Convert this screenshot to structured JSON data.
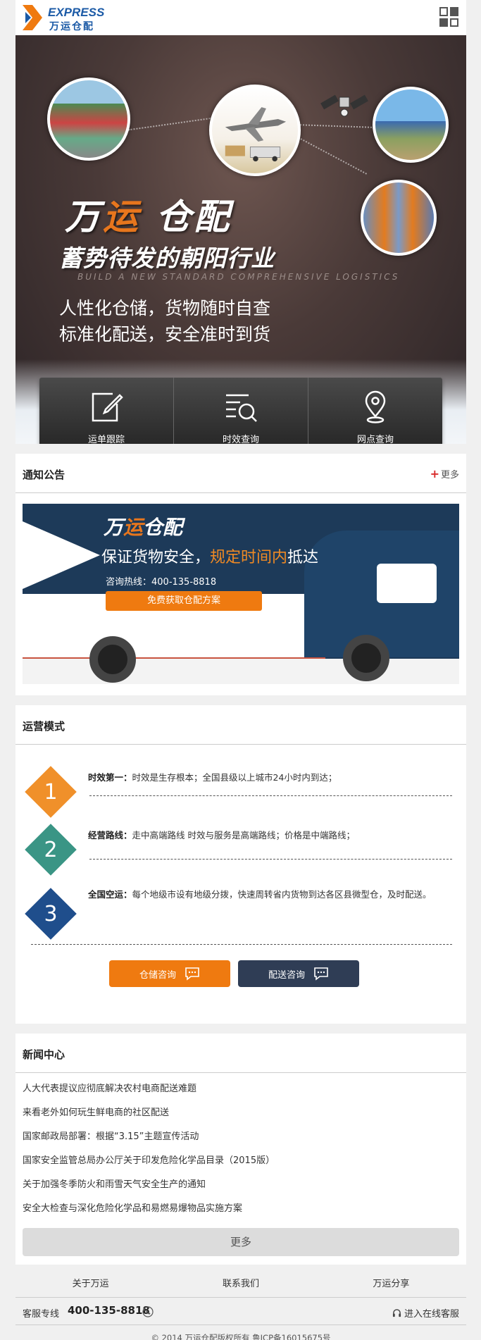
{
  "header": {
    "logo_en": "EXPRESS",
    "logo_cn": "万运仓配",
    "menu_icon": "grid-menu-icon"
  },
  "banner": {
    "brand_part1": "万",
    "brand_part2": "运",
    "brand_part3": " 仓配",
    "tagline": "蓄势待发的朝阳行业",
    "tagline_en": "BUILD A NEW STANDARD COMPREHENSIVE LOGISTICS",
    "line1": "人性化仓储，货物随时自查",
    "line2": "标准化配送，安全准时到货"
  },
  "quick": [
    {
      "label": "运单跟踪",
      "icon": "edit-note-icon"
    },
    {
      "label": "时效查询",
      "icon": "list-search-icon"
    },
    {
      "label": "网点查询",
      "icon": "location-pin-icon"
    }
  ],
  "notice": {
    "title": "通知公告",
    "more": "更多",
    "promo_logo1": "万",
    "promo_logo2": "运",
    "promo_logo3": "仓配",
    "promo_slogan_a": "保证货物安全，",
    "promo_slogan_b": "规定时间内",
    "promo_slogan_c": "抵达",
    "promo_hotline": "咨询热线：400-135-8818",
    "promo_button": "免费获取仓配方案"
  },
  "ops": {
    "title": "运营模式",
    "items": [
      {
        "num": "1",
        "head": "时效第一：",
        "text": "时效是生存根本；全国县级以上城市24小时内到达；",
        "color": "#f0902a"
      },
      {
        "num": "2",
        "head": "经营路线：",
        "text": "走中高端路线 时效与服务是高端路线；价格是中端路线；",
        "color": "#3a9585"
      },
      {
        "num": "3",
        "head": "全国空运：",
        "text": "每个地级市设有地级分拨，快速周转省内货物到达各区县微型仓，及时配送。",
        "color": "#1f4e8c"
      }
    ],
    "btn_storage": "仓储咨询",
    "btn_delivery": "配送咨询"
  },
  "news": {
    "title": "新闻中心",
    "items": [
      "人大代表提议应彻底解决农村电商配送难题",
      "来看老外如何玩生鲜电商的社区配送",
      "国家邮政局部署：根据“3.15”主题宣传活动",
      "国家安全监管总局办公厅关于印发危险化学品目录（2015版）",
      "关于加强冬季防火和雨雪天气安全生产的通知",
      "安全大检查与深化危险化学品和易燃易爆物品实施方案"
    ],
    "more": "更多"
  },
  "footer": {
    "links": [
      "关于万运",
      "联系我们",
      "万运分享"
    ],
    "hotline_label": "客服专线",
    "hotline": "400-135-8818",
    "online": "进入在线客服",
    "copyright": "© 2014 万运仓配版权所有 鲁ICP备16015675号"
  },
  "colors": {
    "accent": "#ef7a10",
    "brand": "#1b5aa6",
    "dark": "#2f3d55",
    "red": "#d92b2b"
  }
}
